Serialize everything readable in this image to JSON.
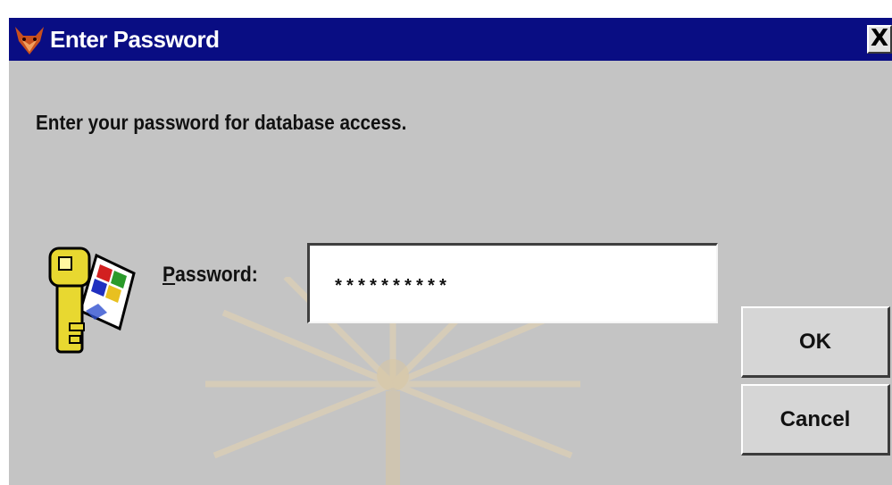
{
  "window": {
    "title": "Enter Password",
    "icon": "fox-icon",
    "close_label": "X"
  },
  "prompt": "Enter your password for database access.",
  "password": {
    "label_mnemonic": "P",
    "label_rest": "assword:",
    "value": "**********",
    "icon": "key-windows-icon"
  },
  "buttons": {
    "ok_label": "OK",
    "cancel_label": "Cancel"
  },
  "colors": {
    "titlebar": "#090d83",
    "dialog_bg": "#c4c4c4",
    "title_text": "#ffffff"
  }
}
